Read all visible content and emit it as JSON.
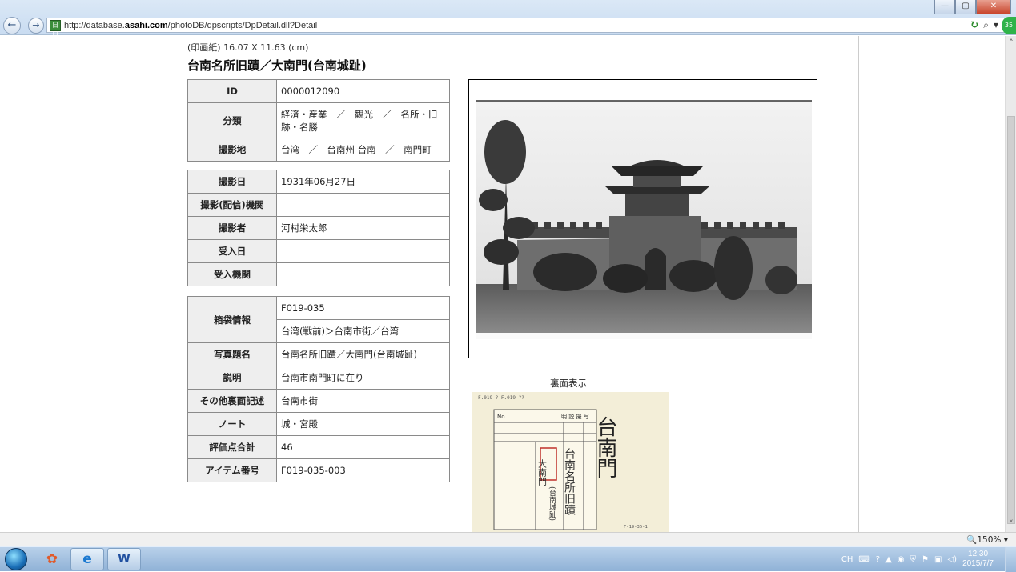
{
  "browser": {
    "url_prefix": "http://database.",
    "url_domain": "asahi.com",
    "url_path": "/photoDB/dpscripts/DpDetail.dll?Detail",
    "site_icon_text": "日日",
    "badge": "35",
    "win_min": "—",
    "win_max": "▢",
    "win_close": "✕",
    "back_glyph": "←",
    "fwd_glyph": "→",
    "search_glyph": "⌕",
    "dropdown_glyph": "▾"
  },
  "page": {
    "paper_size": "(印画紙) 16.07 X 11.63 (cm)",
    "title": "台南名所旧蹟／大南門(台南城趾)",
    "table1": [
      {
        "label": "ID",
        "value": "0000012090"
      },
      {
        "label": "分類",
        "value": "経済・産業　／　観光　／　名所・旧跡・名勝"
      },
      {
        "label": "撮影地",
        "value": "台湾　／　台南州 台南　／　南門町"
      }
    ],
    "table2": [
      {
        "label": "撮影日",
        "value": "1931年06月27日"
      },
      {
        "label": "撮影(配信)機関",
        "value": ""
      },
      {
        "label": "撮影者",
        "value": "河村栄太郎"
      },
      {
        "label": "受入日",
        "value": ""
      },
      {
        "label": "受入機関",
        "value": ""
      }
    ],
    "table3": {
      "box_label": "箱袋情報",
      "box_values": [
        "F019-035",
        "台湾(戦前)＞台南市街／台湾"
      ],
      "rows": [
        {
          "label": "写真題名",
          "value": "台南名所旧蹟／大南門(台南城趾)"
        },
        {
          "label": "説明",
          "value": "台南市南門町に在り"
        },
        {
          "label": "その他裏面記述",
          "value": "台南市街"
        },
        {
          "label": "ノート",
          "value": "城・宮殿"
        },
        {
          "label": "評価点合計",
          "value": "46"
        },
        {
          "label": "アイテム番号",
          "value": "F019-035-003"
        }
      ]
    },
    "back_label": "裏面表示",
    "back_card": {
      "stamp_left": "F.019-?\nF.019-??",
      "header_no": "No.",
      "header_title": "明 説 撮 写",
      "handwriting_main": "台南名所旧蹟",
      "handwriting_box": "大南門",
      "handwriting_side": "(台南城趾)",
      "margin_note": "F-19-35-1"
    }
  },
  "statusbar": {
    "zoom": "🔍150%",
    "zoom_dropdown": "▾"
  },
  "taskbar": {
    "time": "12:30",
    "date": "2015/7/7",
    "ime": "CH",
    "tray_arrow": "▲"
  }
}
